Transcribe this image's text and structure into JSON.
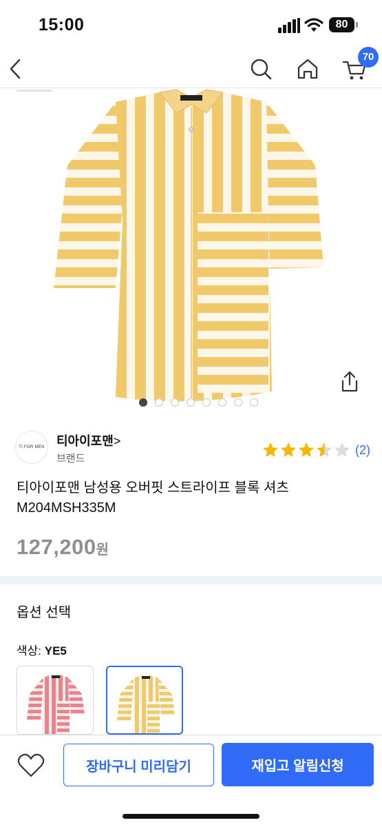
{
  "status_bar": {
    "time": "15:00",
    "battery": "80"
  },
  "nav": {
    "back_icon": "chevron-left-icon",
    "search_icon": "search-icon",
    "home_icon": "home-icon",
    "cart_icon": "cart-icon",
    "cart_count": "70"
  },
  "gallery": {
    "image_count": 8,
    "active_index": 0
  },
  "brand": {
    "logo_text": "TI FOR MEN",
    "name": "티아이포맨",
    "chevron": ">",
    "label": "브랜드"
  },
  "rating": {
    "value": 3.5,
    "max": 5,
    "review_count": "(2)"
  },
  "product": {
    "title": "티아이포맨 남성용 오버핏 스트라이프 블록 셔츠 M204MSH335M",
    "price": "127,200",
    "price_unit": "원"
  },
  "options": {
    "title": "옵션 선택",
    "color_label": "색상:",
    "color_value": "YE5",
    "swatches": [
      {
        "color": "pink",
        "selected": false
      },
      {
        "color": "yellow",
        "selected": true
      }
    ]
  },
  "actions": {
    "wishlist_icon": "heart-icon",
    "cart_preview_label": "장바구니 미리담기",
    "restock_label": "재입고 알림신청"
  },
  "colors": {
    "accent": "#2f6bf6",
    "star": "#f5b800",
    "stripe_yellow": "#f0c96a",
    "stripe_pink": "#e9848d"
  }
}
